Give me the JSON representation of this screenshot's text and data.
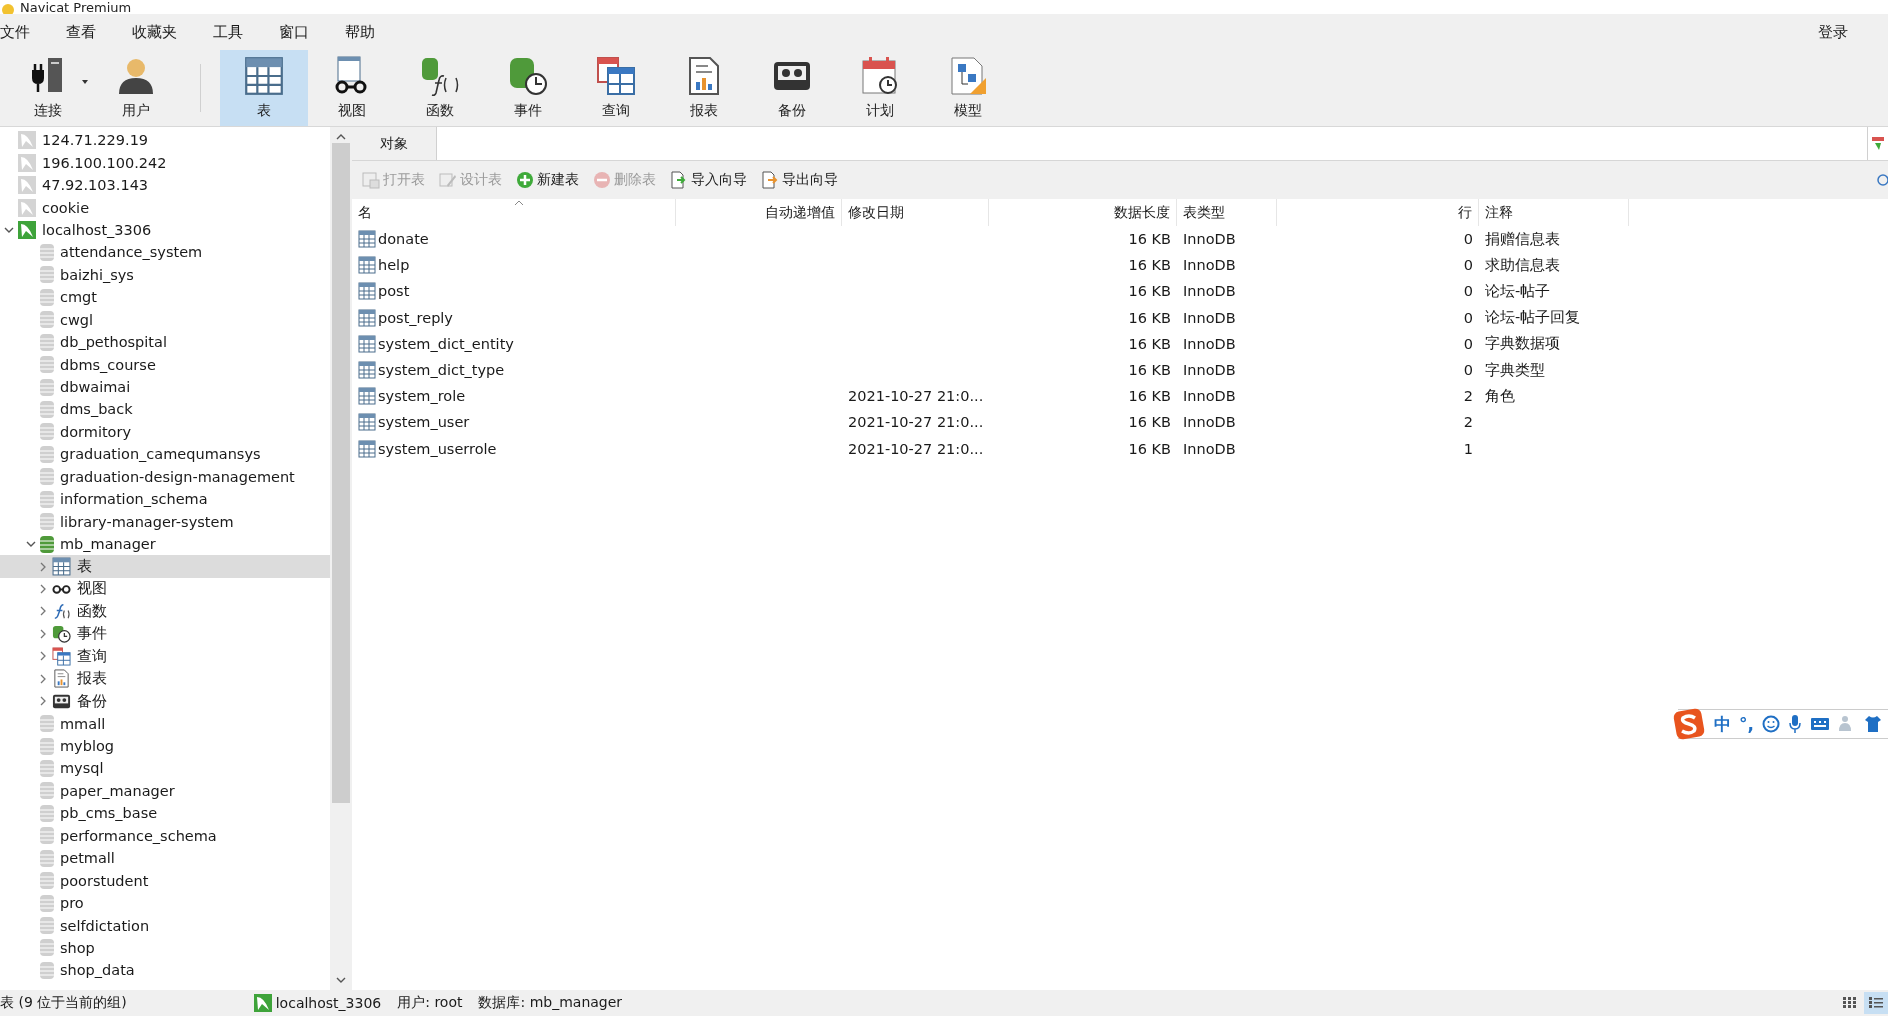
{
  "window": {
    "title": "Navicat Premium"
  },
  "menu": [
    "文件",
    "查看",
    "收藏夹",
    "工具",
    "窗口",
    "帮助"
  ],
  "login": "登录",
  "toolbar": [
    {
      "label": "连接",
      "kind": "connection",
      "selected": false,
      "dropdown": true
    },
    {
      "label": "用户",
      "kind": "user",
      "selected": false,
      "dropdown": false
    },
    {
      "label": "表",
      "kind": "table",
      "selected": true,
      "dropdown": false
    },
    {
      "label": "视图",
      "kind": "view",
      "selected": false,
      "dropdown": false
    },
    {
      "label": "函数",
      "kind": "function",
      "selected": false,
      "dropdown": false
    },
    {
      "label": "事件",
      "kind": "event",
      "selected": false,
      "dropdown": false
    },
    {
      "label": "查询",
      "kind": "query",
      "selected": false,
      "dropdown": false
    },
    {
      "label": "报表",
      "kind": "report",
      "selected": false,
      "dropdown": false
    },
    {
      "label": "备份",
      "kind": "backup",
      "selected": false,
      "dropdown": false
    },
    {
      "label": "计划",
      "kind": "schedule",
      "selected": false,
      "dropdown": false
    },
    {
      "label": "模型",
      "kind": "model",
      "selected": false,
      "dropdown": false
    }
  ],
  "tree": [
    {
      "label": "124.71.229.19",
      "kind": "connection",
      "open": false,
      "expanded": false,
      "selected": false
    },
    {
      "label": "196.100.100.242",
      "kind": "connection",
      "open": false,
      "expanded": false,
      "selected": false
    },
    {
      "label": "47.92.103.143",
      "kind": "connection",
      "open": false,
      "expanded": false,
      "selected": false
    },
    {
      "label": "cookie",
      "kind": "connection",
      "open": false,
      "expanded": false,
      "selected": false
    },
    {
      "label": "localhost_3306",
      "kind": "connection",
      "open": true,
      "expanded": true,
      "selected": false,
      "children": [
        {
          "label": "attendance_system",
          "kind": "database",
          "open": false,
          "expanded": false,
          "selected": false
        },
        {
          "label": "baizhi_sys",
          "kind": "database",
          "open": false,
          "expanded": false,
          "selected": false
        },
        {
          "label": "cmgt",
          "kind": "database",
          "open": false,
          "expanded": false,
          "selected": false
        },
        {
          "label": "cwgl",
          "kind": "database",
          "open": false,
          "expanded": false,
          "selected": false
        },
        {
          "label": "db_pethospital",
          "kind": "database",
          "open": false,
          "expanded": false,
          "selected": false
        },
        {
          "label": "dbms_course",
          "kind": "database",
          "open": false,
          "expanded": false,
          "selected": false
        },
        {
          "label": "dbwaimai",
          "kind": "database",
          "open": false,
          "expanded": false,
          "selected": false
        },
        {
          "label": "dms_back",
          "kind": "database",
          "open": false,
          "expanded": false,
          "selected": false
        },
        {
          "label": "dormitory",
          "kind": "database",
          "open": false,
          "expanded": false,
          "selected": false
        },
        {
          "label": "graduation_camequmansys",
          "kind": "database",
          "open": false,
          "expanded": false,
          "selected": false
        },
        {
          "label": "graduation-design-management",
          "kind": "database",
          "open": false,
          "expanded": false,
          "selected": false
        },
        {
          "label": "information_schema",
          "kind": "database",
          "open": false,
          "expanded": false,
          "selected": false
        },
        {
          "label": "library-manager-system",
          "kind": "database",
          "open": false,
          "expanded": false,
          "selected": false
        },
        {
          "label": "mb_manager",
          "kind": "database",
          "open": true,
          "expanded": true,
          "selected": false,
          "children": [
            {
              "label": "表",
              "kind": "table",
              "expanded": false,
              "selected": true
            },
            {
              "label": "视图",
              "kind": "view",
              "expanded": false,
              "selected": false
            },
            {
              "label": "函数",
              "kind": "function",
              "expanded": false,
              "selected": false
            },
            {
              "label": "事件",
              "kind": "event",
              "expanded": false,
              "selected": false
            },
            {
              "label": "查询",
              "kind": "query",
              "expanded": false,
              "selected": false
            },
            {
              "label": "报表",
              "kind": "report",
              "expanded": false,
              "selected": false
            },
            {
              "label": "备份",
              "kind": "backup",
              "expanded": false,
              "selected": false
            }
          ]
        },
        {
          "label": "mmall",
          "kind": "database",
          "open": false,
          "expanded": false,
          "selected": false
        },
        {
          "label": "myblog",
          "kind": "database",
          "open": false,
          "expanded": false,
          "selected": false
        },
        {
          "label": "mysql",
          "kind": "database",
          "open": false,
          "expanded": false,
          "selected": false
        },
        {
          "label": "paper_manager",
          "kind": "database",
          "open": false,
          "expanded": false,
          "selected": false
        },
        {
          "label": "pb_cms_base",
          "kind": "database",
          "open": false,
          "expanded": false,
          "selected": false
        },
        {
          "label": "performance_schema",
          "kind": "database",
          "open": false,
          "expanded": false,
          "selected": false
        },
        {
          "label": "petmall",
          "kind": "database",
          "open": false,
          "expanded": false,
          "selected": false
        },
        {
          "label": "poorstudent",
          "kind": "database",
          "open": false,
          "expanded": false,
          "selected": false
        },
        {
          "label": "pro",
          "kind": "database",
          "open": false,
          "expanded": false,
          "selected": false
        },
        {
          "label": "selfdictation",
          "kind": "database",
          "open": false,
          "expanded": false,
          "selected": false
        },
        {
          "label": "shop",
          "kind": "database",
          "open": false,
          "expanded": false,
          "selected": false
        },
        {
          "label": "shop_data",
          "kind": "database",
          "open": false,
          "expanded": false,
          "selected": false
        }
      ]
    }
  ],
  "tabs": [
    {
      "label": "对象",
      "selected": true
    }
  ],
  "actions": [
    {
      "label": "打开表",
      "kind": "open",
      "disabled": true
    },
    {
      "label": "设计表",
      "kind": "design",
      "disabled": true
    },
    {
      "label": "新建表",
      "kind": "new",
      "disabled": false
    },
    {
      "label": "删除表",
      "kind": "delete",
      "disabled": true
    },
    {
      "label": "导入向导",
      "kind": "import",
      "disabled": false
    },
    {
      "label": "导出向导",
      "kind": "export",
      "disabled": false
    }
  ],
  "table": {
    "columns": [
      {
        "label": "名",
        "sorted": true
      },
      {
        "label": "自动递增值",
        "sorted": false
      },
      {
        "label": "修改日期",
        "sorted": false
      },
      {
        "label": "数据长度",
        "sorted": false
      },
      {
        "label": "表类型",
        "sorted": false
      },
      {
        "label": "行",
        "sorted": false
      },
      {
        "label": "注释",
        "sorted": false
      }
    ],
    "rows": [
      {
        "cells": [
          "donate",
          null,
          null,
          "16 KB",
          "InnoDB",
          "0",
          "捐赠信息表"
        ]
      },
      {
        "cells": [
          "help",
          null,
          null,
          "16 KB",
          "InnoDB",
          "0",
          "求助信息表"
        ]
      },
      {
        "cells": [
          "post",
          null,
          null,
          "16 KB",
          "InnoDB",
          "0",
          "论坛-帖子"
        ]
      },
      {
        "cells": [
          "post_reply",
          null,
          null,
          "16 KB",
          "InnoDB",
          "0",
          "论坛-帖子回复"
        ]
      },
      {
        "cells": [
          "system_dict_entity",
          null,
          null,
          "16 KB",
          "InnoDB",
          "0",
          "字典数据项"
        ]
      },
      {
        "cells": [
          "system_dict_type",
          null,
          null,
          "16 KB",
          "InnoDB",
          "0",
          "字典类型"
        ]
      },
      {
        "cells": [
          "system_role",
          null,
          "2021-10-27 21:0...",
          "16 KB",
          "InnoDB",
          "2",
          "角色"
        ]
      },
      {
        "cells": [
          "system_user",
          null,
          "2021-10-27 21:0...",
          "16 KB",
          "InnoDB",
          "2",
          null
        ]
      },
      {
        "cells": [
          "system_userrole",
          null,
          "2021-10-27 21:0...",
          "16 KB",
          "InnoDB",
          "1",
          null
        ]
      }
    ]
  },
  "ime": {
    "mode": "中",
    "punct": "°,"
  },
  "status_bar": {
    "summary": "表 (9 位于当前的组)",
    "connection": "localhost_3306",
    "user": "用户: root",
    "database": "数据库: mb_manager",
    "views": [
      {
        "kind": "grid",
        "selected": false
      },
      {
        "kind": "list",
        "selected": true
      }
    ]
  }
}
